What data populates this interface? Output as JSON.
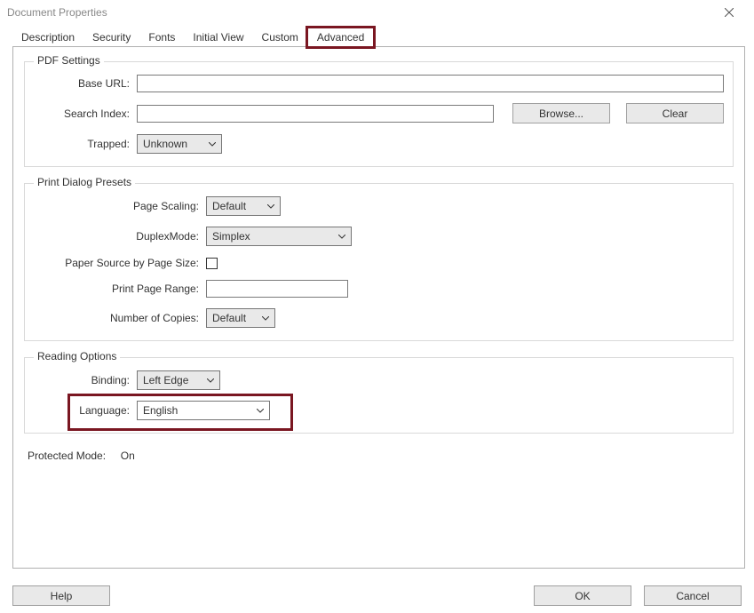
{
  "window": {
    "title": "Document Properties"
  },
  "tabs": {
    "description": "Description",
    "security": "Security",
    "fonts": "Fonts",
    "initial_view": "Initial View",
    "custom": "Custom",
    "advanced": "Advanced"
  },
  "pdf_settings": {
    "legend": "PDF Settings",
    "base_url_label": "Base URL:",
    "base_url_value": "",
    "search_index_label": "Search Index:",
    "search_index_value": "",
    "browse_btn": "Browse...",
    "clear_btn": "Clear",
    "trapped_label": "Trapped:",
    "trapped_value": "Unknown"
  },
  "print_presets": {
    "legend": "Print Dialog Presets",
    "page_scaling_label": "Page Scaling:",
    "page_scaling_value": "Default",
    "duplex_label": "DuplexMode:",
    "duplex_value": "Simplex",
    "paper_source_label": "Paper Source by Page Size:",
    "print_page_range_label": "Print Page Range:",
    "print_page_range_value": "",
    "num_copies_label": "Number of Copies:",
    "num_copies_value": "Default"
  },
  "reading_options": {
    "legend": "Reading Options",
    "binding_label": "Binding:",
    "binding_value": "Left Edge",
    "language_label": "Language:",
    "language_value": "English"
  },
  "protected_mode": {
    "label": "Protected Mode:",
    "value": "On"
  },
  "footer": {
    "help": "Help",
    "ok": "OK",
    "cancel": "Cancel"
  }
}
